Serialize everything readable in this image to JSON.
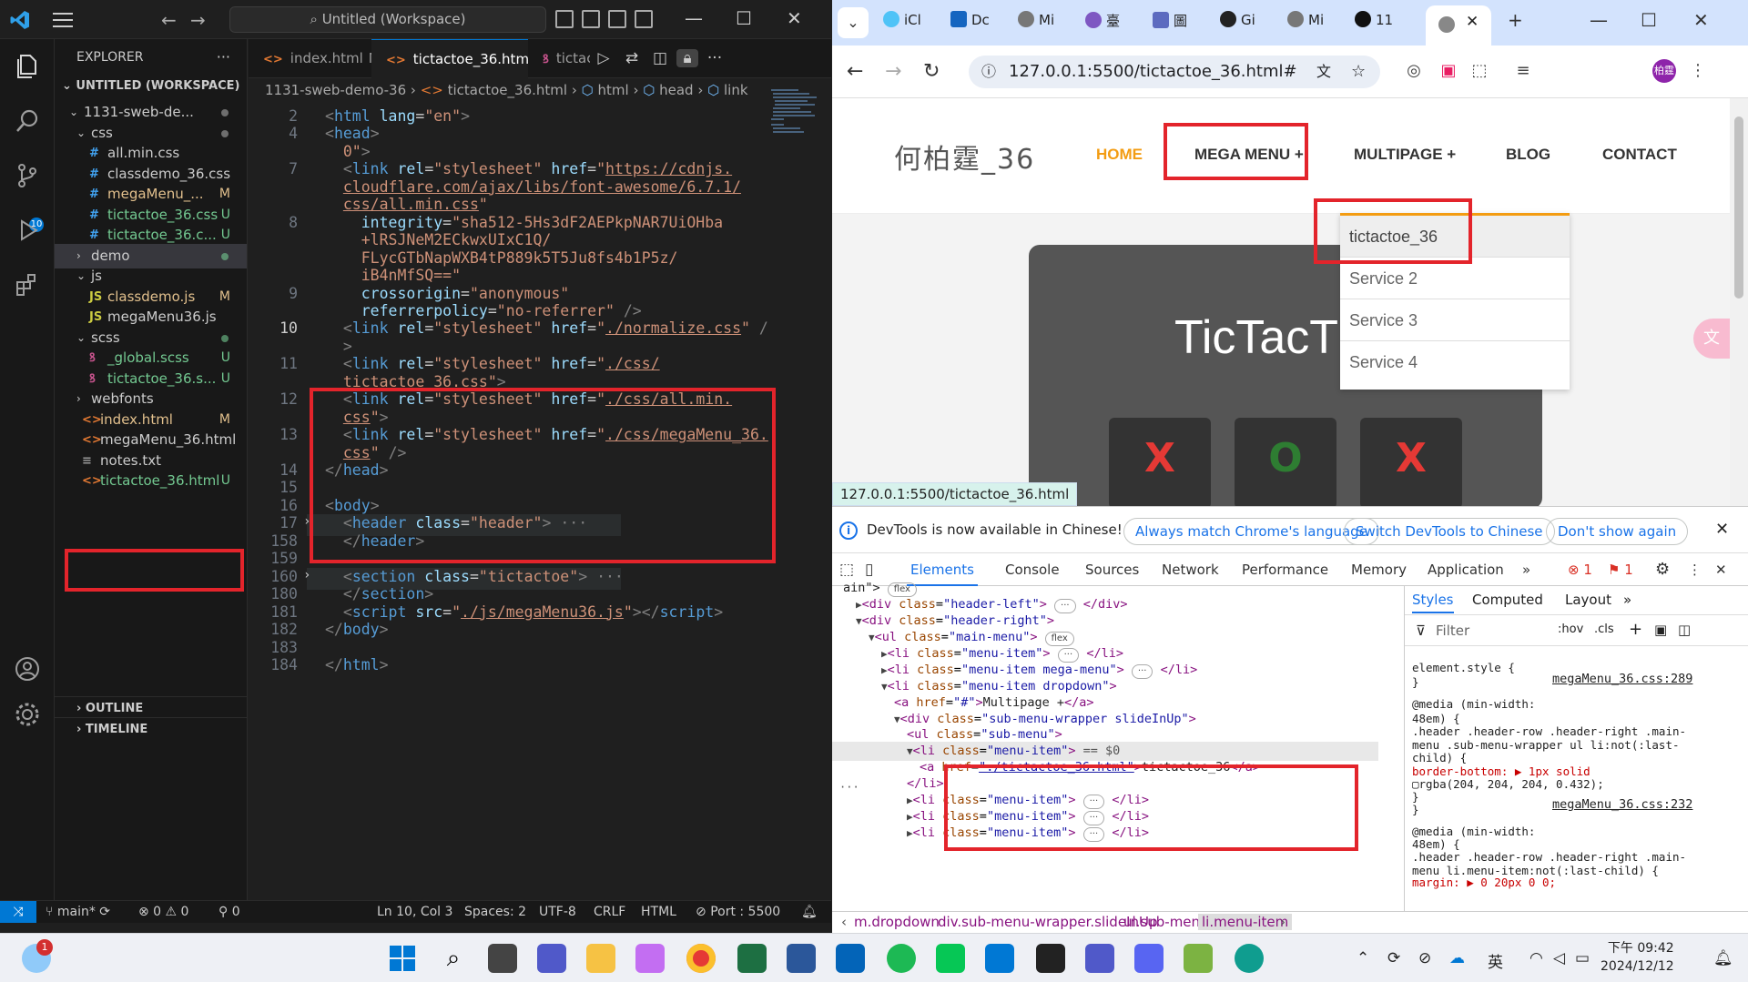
{
  "vscode": {
    "search_label": "Untitled (Workspace)",
    "explorer_title": "EXPLORER",
    "workspace_title": "UNTITLED (WORKSPACE)",
    "scm_badge": "10",
    "tree": [
      {
        "name": "1131-sweb-de...",
        "type": "folder",
        "status": ""
      },
      {
        "name": "css",
        "type": "folder",
        "status": ""
      },
      {
        "name": "all.min.css",
        "type": "css",
        "status": ""
      },
      {
        "name": "classdemo_36.css",
        "type": "css",
        "status": ""
      },
      {
        "name": "megaMenu_...",
        "type": "css",
        "status": "M"
      },
      {
        "name": "tictactoe_36.css",
        "type": "css",
        "status": "U"
      },
      {
        "name": "tictactoe_36.c...",
        "type": "css",
        "status": "U"
      },
      {
        "name": "demo",
        "type": "folder",
        "status": ""
      },
      {
        "name": "js",
        "type": "folder",
        "status": ""
      },
      {
        "name": "classdemo.js",
        "type": "js",
        "status": "M"
      },
      {
        "name": "megaMenu36.js",
        "type": "js",
        "status": ""
      },
      {
        "name": "scss",
        "type": "folder",
        "status": ""
      },
      {
        "name": "_global.scss",
        "type": "scss",
        "status": "U"
      },
      {
        "name": "tictactoe_36.s...",
        "type": "scss",
        "status": "U"
      },
      {
        "name": "webfonts",
        "type": "folder",
        "status": ""
      },
      {
        "name": "index.html",
        "type": "html",
        "status": "M"
      },
      {
        "name": "megaMenu_36.html",
        "type": "html",
        "status": ""
      },
      {
        "name": "notes.txt",
        "type": "txt",
        "status": ""
      },
      {
        "name": "tictactoe_36.html",
        "type": "html",
        "status": "U"
      }
    ],
    "outline_label": "OUTLINE",
    "timeline_label": "TIMELINE",
    "tabs": [
      {
        "label": "index.html",
        "mark": "M"
      },
      {
        "label": "tictactoe_36.html",
        "mark": "U"
      },
      {
        "label": "tictac",
        "mark": ""
      }
    ],
    "breadcrumb": [
      "1131-sweb-demo-36",
      "tictactoe_36.html",
      "html",
      "head",
      "link"
    ],
    "status": {
      "branch": "main*",
      "problems": "⊗ 0 ⚠ 0",
      "ports": "0",
      "position": "Ln 10, Col 3",
      "spaces": "Spaces: 2",
      "encoding": "UTF-8",
      "eol": "CRLF",
      "language": "HTML",
      "port": "Port : 5500"
    }
  },
  "code_lines": [
    {
      "n": "2",
      "html": "<span class='pu'>&lt;</span><span class='tg'>html</span> <span class='at'>lang</span>=<span class='st'>\"en\"</span><span class='pu'>&gt;</span>"
    },
    {
      "n": "4",
      "html": "<span class='pu'>&lt;</span><span class='tg'>head</span><span class='pu'>&gt;</span>"
    },
    {
      "n": "",
      "html": "&nbsp;&nbsp;<span class='st'>0\"</span><span class='pu'>&gt;</span>"
    },
    {
      "n": "7",
      "html": "&nbsp;&nbsp;<span class='pu'>&lt;</span><span class='tg'>link</span> <span class='at'>rel</span>=<span class='st'>\"stylesheet\"</span> <span class='at'>href</span>=<span class='st'>\"</span><span class='lk'>https://cdnjs.</span>"
    },
    {
      "n": "",
      "html": "&nbsp;&nbsp;<span class='lk'>cloudflare.com/ajax/libs/font-awesome/6.7.1/</span>"
    },
    {
      "n": "",
      "html": "&nbsp;&nbsp;<span class='lk'>css/all.min.css</span><span class='st'>\"</span>"
    },
    {
      "n": "8",
      "html": "&nbsp;&nbsp;&nbsp;&nbsp;<span class='at'>integrity</span>=<span class='st'>\"sha512-5Hs3dF2AEPkpNAR7UiOHba</span>"
    },
    {
      "n": "",
      "html": "&nbsp;&nbsp;&nbsp;&nbsp;<span class='st'>+lRSJNeM2ECkwxUIxC1Q/</span>"
    },
    {
      "n": "",
      "html": "&nbsp;&nbsp;&nbsp;&nbsp;<span class='st'>FLycGTbNapWXB4tP889k5T5Ju8fs4b1P5z/</span>"
    },
    {
      "n": "",
      "html": "&nbsp;&nbsp;&nbsp;&nbsp;<span class='st'>iB4nMfSQ==\"</span>"
    },
    {
      "n": "9",
      "html": "&nbsp;&nbsp;&nbsp;&nbsp;<span class='at'>crossorigin</span>=<span class='st'>\"anonymous\"</span>"
    },
    {
      "n": "",
      "html": "&nbsp;&nbsp;&nbsp;&nbsp;<span class='at'>referrerpolicy</span>=<span class='st'>\"no-referrer\"</span> <span class='pu'>/&gt;</span>"
    },
    {
      "n": "10",
      "html": "&nbsp;&nbsp;<span class='pu'>&lt;</span><span class='tg'>link</span> <span class='at'>rel</span>=<span class='st'>\"stylesheet\"</span> <span class='at'>href</span>=<span class='st'>\"</span><span class='lk'>./normalize.css</span><span class='st'>\"</span> <span class='pu'>/</span>",
      "cur": true
    },
    {
      "n": "",
      "html": "&nbsp;&nbsp;<span class='pu'>&gt;</span>"
    },
    {
      "n": "11",
      "html": "&nbsp;&nbsp;<span class='pu'>&lt;</span><span class='tg'>link</span> <span class='at'>rel</span>=<span class='st'>\"stylesheet\"</span> <span class='at'>href</span>=<span class='st'>\"</span><span class='lk'>./css/</span>"
    },
    {
      "n": "",
      "html": "&nbsp;&nbsp;<span class='lk'>tictactoe_36.css</span><span class='st'>\"</span><span class='pu'>&gt;</span>"
    },
    {
      "n": "12",
      "html": "&nbsp;&nbsp;<span class='pu'>&lt;</span><span class='tg'>link</span> <span class='at'>rel</span>=<span class='st'>\"stylesheet\"</span> <span class='at'>href</span>=<span class='st'>\"</span><span class='lk'>./css/all.min.</span>"
    },
    {
      "n": "",
      "html": "&nbsp;&nbsp;<span class='lk'>css</span><span class='st'>\"</span><span class='pu'>&gt;</span>"
    },
    {
      "n": "13",
      "html": "&nbsp;&nbsp;<span class='pu'>&lt;</span><span class='tg'>link</span> <span class='at'>rel</span>=<span class='st'>\"stylesheet\"</span> <span class='at'>href</span>=<span class='st'>\"</span><span class='lk'>./css/megaMenu_36.</span>"
    },
    {
      "n": "",
      "html": "&nbsp;&nbsp;<span class='lk'>css</span><span class='st'>\"</span> <span class='pu'>/&gt;</span>"
    },
    {
      "n": "14",
      "html": "<span class='pu'>&lt;/</span><span class='tg'>head</span><span class='pu'>&gt;</span>"
    },
    {
      "n": "15",
      "html": ""
    },
    {
      "n": "16",
      "html": "<span class='pu'>&lt;</span><span class='tg'>body</span><span class='pu'>&gt;</span>"
    },
    {
      "n": "17",
      "html": "&nbsp;&nbsp;<span class='pu'>&lt;</span><span class='tg'>header</span> <span class='at'>class</span>=<span class='st'>\"header\"</span><span class='pu'>&gt;</span> <span class='pu'>···</span>",
      "fold": true
    },
    {
      "n": "158",
      "html": "&nbsp;&nbsp;<span class='pu'>&lt;/</span><span class='tg'>header</span><span class='pu'>&gt;</span>"
    },
    {
      "n": "159",
      "html": ""
    },
    {
      "n": "160",
      "html": "&nbsp;&nbsp;<span class='pu'>&lt;</span><span class='tg'>section</span> <span class='at'>class</span>=<span class='st'>\"tictactoe\"</span><span class='pu'>&gt;</span> <span class='pu'>···</span>",
      "fold": true
    },
    {
      "n": "180",
      "html": "&nbsp;&nbsp;<span class='pu'>&lt;/</span><span class='tg'>section</span><span class='pu'>&gt;</span>"
    },
    {
      "n": "181",
      "html": "&nbsp;&nbsp;<span class='pu'>&lt;</span><span class='tg'>script</span> <span class='at'>src</span>=<span class='st'>\"</span><span class='lk'>./js/megaMenu36.js</span><span class='st'>\"</span><span class='pu'>&gt;&lt;/</span><span class='tg'>script</span><span class='pu'>&gt;</span>"
    },
    {
      "n": "182",
      "html": "<span class='pu'>&lt;/</span><span class='tg'>body</span><span class='pu'>&gt;</span>"
    },
    {
      "n": "183",
      "html": ""
    },
    {
      "n": "184",
      "html": "<span class='pu'>&lt;/</span><span class='tg'>html</span><span class='pu'>&gt;</span>"
    }
  ],
  "chrome": {
    "tabs": [
      "iCl",
      "Dc",
      "Mi",
      "臺",
      "圖",
      "Gi",
      "Mi",
      "11"
    ],
    "url": "127.0.0.1:5500/tictactoe_36.html#",
    "avatar": "柏霆",
    "page": {
      "logo": "何柏霆_36",
      "menu": [
        "HOME",
        "MEGA MENU +",
        "MULTIPAGE +",
        "BLOG",
        "CONTACT"
      ],
      "board_title": "TicTacT",
      "cells": [
        "X",
        "O",
        "X"
      ],
      "dropdown": [
        "tictactoe_36",
        "Service 2",
        "Service 3",
        "Service 4"
      ]
    },
    "status_url": "127.0.0.1:5500/tictactoe_36.html",
    "devtools_banner": {
      "message": "DevTools is now available in Chinese!",
      "btn_match": "Always match Chrome's language",
      "btn_switch": "Switch DevTools to Chinese",
      "btn_dont": "Don't show again"
    },
    "devtools_tabs": [
      "Elements",
      "Console",
      "Sources",
      "Network",
      "Performance",
      "Memory",
      "Application"
    ],
    "errors": "1",
    "warnings": "1",
    "style_tabs": [
      "Styles",
      "Computed",
      "Layout"
    ],
    "filter_placeholder": "Filter",
    "hov_label": ":hov",
    "cls_label": ".cls",
    "breadcrumbs": [
      "m.dropdown",
      "div.sub-menu-wrapper.slideInUp",
      "ul.sub-menu",
      "li.menu-item"
    ]
  },
  "dom_lines": [
    {
      "ind": 0,
      "html": "<span class='x'>ain\"&gt;</span> <span class='badge'>flex</span>"
    },
    {
      "ind": 1,
      "html": "<span class='tri'>▶</span><span class='t'>&lt;div</span> <span class='a'>class</span>=<span class='v'>\"header-left\"</span><span class='t'>&gt;</span> <span class='badge'>···</span> <span class='t'>&lt;/div&gt;</span>"
    },
    {
      "ind": 1,
      "html": "<span class='tri'>▼</span><span class='t'>&lt;div</span> <span class='a'>class</span>=<span class='v'>\"header-right\"</span><span class='t'>&gt;</span>"
    },
    {
      "ind": 2,
      "html": "<span class='tri'>▼</span><span class='t'>&lt;ul</span> <span class='a'>class</span>=<span class='v'>\"main-menu\"</span><span class='t'>&gt;</span> <span class='badge'>flex</span>"
    },
    {
      "ind": 3,
      "html": "<span class='tri'>▶</span><span class='t'>&lt;li</span> <span class='a'>class</span>=<span class='v'>\"menu-item\"</span><span class='t'>&gt;</span> <span class='badge'>···</span> <span class='t'>&lt;/li&gt;</span>"
    },
    {
      "ind": 3,
      "html": "<span class='tri'>▶</span><span class='t'>&lt;li</span> <span class='a'>class</span>=<span class='v'>\"menu-item mega-menu\"</span><span class='t'>&gt;</span> <span class='badge'>···</span> <span class='t'>&lt;/li&gt;</span>"
    },
    {
      "ind": 3,
      "html": "<span class='tri'>▼</span><span class='t'>&lt;li</span> <span class='a'>class</span>=<span class='v'>\"menu-item dropdown\"</span><span class='t'>&gt;</span>"
    },
    {
      "ind": 4,
      "html": "<span class='t'>&lt;a</span> <span class='a'>href</span>=<span class='v'>\"#\"</span><span class='t'>&gt;</span><span class='x'>Multipage +</span><span class='t'>&lt;/a&gt;</span>"
    },
    {
      "ind": 4,
      "html": "<span class='tri'>▼</span><span class='t'>&lt;div</span> <span class='a'>class</span>=<span class='v'>\"sub-menu-wrapper slideInUp\"</span><span class='t'>&gt;</span>"
    },
    {
      "ind": 5,
      "html": "<span class='t'>&lt;ul</span> <span class='a'>class</span>=<span class='v'>\"sub-menu\"</span><span class='t'>&gt;</span>"
    },
    {
      "ind": 5,
      "html": "<span class='tri'>▼</span><span class='t'>&lt;li</span> <span class='a'>class</span>=<span class='v'>\"menu-item\"</span><span class='t'>&gt;</span> <span class='e'>== $0</span>"
    },
    {
      "ind": 6,
      "html": "<span class='t'>&lt;a</span> <span class='a'>href</span>=<span class='v' style='text-decoration:underline'>\"./tictactoe_36.html\"</span><span class='t'>&gt;</span><span class='x'>tictactoe_36</span><span class='t'>&lt;/a&gt;</span>"
    },
    {
      "ind": 5,
      "html": "<span class='t'>&lt;/li&gt;</span>"
    },
    {
      "ind": 5,
      "html": "<span class='tri'>▶</span><span class='t'>&lt;li</span> <span class='a'>class</span>=<span class='v'>\"menu-item\"</span><span class='t'>&gt;</span> <span class='badge'>···</span> <span class='t'>&lt;/li&gt;</span>"
    },
    {
      "ind": 5,
      "html": "<span class='tri'>▶</span><span class='t'>&lt;li</span> <span class='a'>class</span>=<span class='v'>\"menu-item\"</span><span class='t'>&gt;</span> <span class='badge'>···</span> <span class='t'>&lt;/li&gt;</span>"
    },
    {
      "ind": 5,
      "html": "<span class='tri'>▶</span><span class='t'>&lt;li</span> <span class='a'>class</span>=<span class='v'>\"menu-item\"</span><span class='t'>&gt;</span> <span class='badge'>···</span> <span class='t'>&lt;/li&gt;</span>"
    }
  ],
  "style_lines": [
    "element.style {",
    "}",
    "@media (min-width:",
    "48em) {",
    " .header .header-row .header-right .main-",
    " menu .sub-menu-wrapper ul li:not(:last-",
    " child) {",
    "    border-bottom: ▶ 1px solid",
    "    ▢rgba(204, 204, 204, 0.432);",
    "  }",
    "}",
    "@media (min-width:",
    "48em) {",
    " .header .header-row .header-right .main-",
    " menu li.menu-item:not(:last-child) {",
    "    margin: ▶ 0 20px 0 0;"
  ],
  "style_sources": [
    "megaMenu_36.css:289",
    "megaMenu_36.css:232"
  ],
  "taskbar": {
    "weather_badge": "1",
    "time": "下午 09:42",
    "date": "2024/12/12",
    "ime": "英"
  },
  "colors": {
    "accent_orange": "#f39c12",
    "annotation_red": "#e3242b",
    "vscode_blue": "#0078d4"
  }
}
